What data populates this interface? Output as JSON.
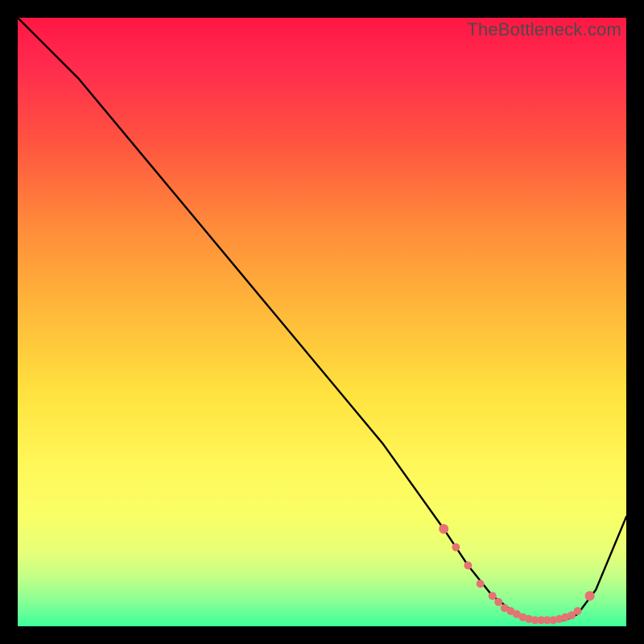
{
  "watermark": "TheBottleneck.com",
  "chart_data": {
    "type": "line",
    "title": "",
    "xlabel": "",
    "ylabel": "",
    "xlim": [
      0,
      100
    ],
    "ylim": [
      0,
      100
    ],
    "series": [
      {
        "name": "curve",
        "x": [
          0,
          5,
          10,
          20,
          30,
          40,
          50,
          60,
          65,
          70,
          74,
          78,
          82,
          86,
          90,
          92,
          95,
          100
        ],
        "y": [
          100,
          95,
          90,
          78,
          66,
          54,
          42,
          30,
          23,
          16,
          10,
          5,
          2,
          1,
          1,
          2,
          6,
          18
        ]
      }
    ],
    "markers": {
      "name": "highlight-dots",
      "color": "#e57373",
      "x": [
        70,
        72,
        74,
        76,
        78,
        79,
        80,
        81,
        82,
        83,
        84,
        85,
        86,
        87,
        88,
        89,
        90,
        91,
        92,
        94
      ],
      "y": [
        16,
        13,
        10,
        7,
        5,
        4,
        3,
        2.5,
        2,
        1.5,
        1.2,
        1,
        1,
        1,
        1,
        1.2,
        1.5,
        1.8,
        2.5,
        5
      ]
    },
    "gradient_stops": [
      {
        "offset": 0,
        "color": "#ff1744"
      },
      {
        "offset": 20,
        "color": "#ff5240"
      },
      {
        "offset": 48,
        "color": "#ffb83a"
      },
      {
        "offset": 74,
        "color": "#fff85a"
      },
      {
        "offset": 92,
        "color": "#c2ff88"
      },
      {
        "offset": 100,
        "color": "#3cff9a"
      }
    ]
  }
}
